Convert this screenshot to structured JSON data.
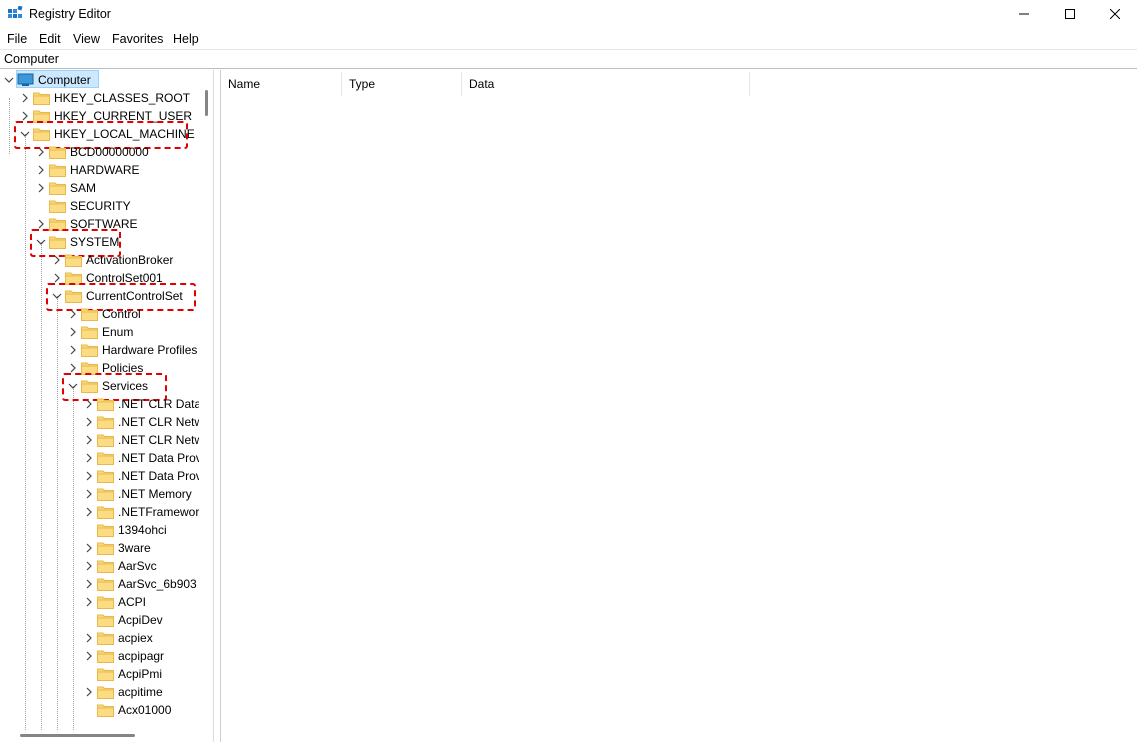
{
  "window": {
    "title": "Registry Editor"
  },
  "menu": [
    "File",
    "Edit",
    "View",
    "Favorites",
    "Help"
  ],
  "address": "Computer",
  "list": {
    "columns": [
      "Name",
      "Type",
      "Data"
    ]
  },
  "tree": [
    {
      "label": "Computer",
      "level": 0,
      "exp": "open"
    },
    {
      "label": "HKEY_CLASSES_ROOT",
      "level": 1,
      "exp": "closed"
    },
    {
      "label": "HKEY_CURRENT_USER",
      "level": 1,
      "exp": "closed"
    },
    {
      "label": "HKEY_LOCAL_MACHINE",
      "level": 1,
      "exp": "open",
      "highlight": true
    },
    {
      "label": "BCD00000000",
      "level": 2,
      "exp": "closed"
    },
    {
      "label": "HARDWARE",
      "level": 2,
      "exp": "closed"
    },
    {
      "label": "SAM",
      "level": 2,
      "exp": "closed"
    },
    {
      "label": "SECURITY",
      "level": 2,
      "exp": "none"
    },
    {
      "label": "SOFTWARE",
      "level": 2,
      "exp": "closed"
    },
    {
      "label": "SYSTEM",
      "level": 2,
      "exp": "open",
      "highlight": true
    },
    {
      "label": "ActivationBroker",
      "level": 3,
      "exp": "closed"
    },
    {
      "label": "ControlSet001",
      "level": 3,
      "exp": "closed"
    },
    {
      "label": "CurrentControlSet",
      "level": 3,
      "exp": "open",
      "highlight": true
    },
    {
      "label": "Control",
      "level": 4,
      "exp": "closed"
    },
    {
      "label": "Enum",
      "level": 4,
      "exp": "closed"
    },
    {
      "label": "Hardware Profiles",
      "level": 4,
      "exp": "closed"
    },
    {
      "label": "Policies",
      "level": 4,
      "exp": "closed"
    },
    {
      "label": "Services",
      "level": 4,
      "exp": "open",
      "highlight": true
    },
    {
      "label": ".NET CLR Data",
      "level": 5,
      "exp": "closed"
    },
    {
      "label": ".NET CLR Netw",
      "level": 5,
      "exp": "closed"
    },
    {
      "label": ".NET CLR Netw",
      "level": 5,
      "exp": "closed"
    },
    {
      "label": ".NET Data Prov",
      "level": 5,
      "exp": "closed"
    },
    {
      "label": ".NET Data Prov",
      "level": 5,
      "exp": "closed"
    },
    {
      "label": ".NET Memory",
      "level": 5,
      "exp": "closed"
    },
    {
      "label": ".NETFramewor",
      "level": 5,
      "exp": "closed"
    },
    {
      "label": "1394ohci",
      "level": 5,
      "exp": "none"
    },
    {
      "label": "3ware",
      "level": 5,
      "exp": "closed"
    },
    {
      "label": "AarSvc",
      "level": 5,
      "exp": "closed"
    },
    {
      "label": "AarSvc_6b903",
      "level": 5,
      "exp": "closed"
    },
    {
      "label": "ACPI",
      "level": 5,
      "exp": "closed"
    },
    {
      "label": "AcpiDev",
      "level": 5,
      "exp": "none"
    },
    {
      "label": "acpiex",
      "level": 5,
      "exp": "closed"
    },
    {
      "label": "acpipagr",
      "level": 5,
      "exp": "closed"
    },
    {
      "label": "AcpiPmi",
      "level": 5,
      "exp": "none"
    },
    {
      "label": "acpitime",
      "level": 5,
      "exp": "closed"
    },
    {
      "label": "Acx01000",
      "level": 5,
      "exp": "none"
    }
  ],
  "colors": {
    "highlight": "#e00000",
    "folder": "#f8d775",
    "folder_dark": "#e8b84a",
    "selection": "#cce8ff"
  }
}
